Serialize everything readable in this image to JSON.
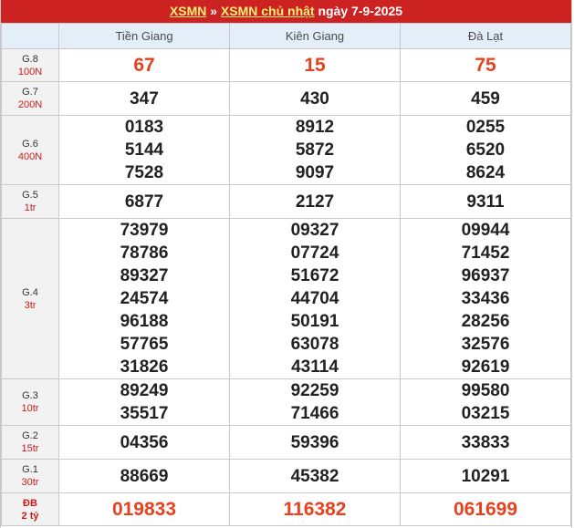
{
  "header": {
    "link1": "XSMN",
    "separator": "»",
    "link2": "XSMN chủ nhật",
    "date_text": "ngày 7-9-2025"
  },
  "provinces": [
    "Tiền Giang",
    "Kiên Giang",
    "Đà Lạt"
  ],
  "prizes": [
    {
      "name": "G.8",
      "value": "100N",
      "results": [
        [
          "67"
        ],
        [
          "15"
        ],
        [
          "75"
        ]
      ]
    },
    {
      "name": "G.7",
      "value": "200N",
      "results": [
        [
          "347"
        ],
        [
          "430"
        ],
        [
          "459"
        ]
      ]
    },
    {
      "name": "G.6",
      "value": "400N",
      "results": [
        [
          "0183",
          "5144",
          "7528"
        ],
        [
          "8912",
          "5872",
          "9097"
        ],
        [
          "0255",
          "6520",
          "8624"
        ]
      ]
    },
    {
      "name": "G.5",
      "value": "1tr",
      "results": [
        [
          "6877"
        ],
        [
          "2127"
        ],
        [
          "9311"
        ]
      ]
    },
    {
      "name": "G.4",
      "value": "3tr",
      "results": [
        [
          "73979",
          "78786",
          "89327",
          "24574",
          "96188",
          "57765",
          "31826"
        ],
        [
          "09327",
          "07724",
          "51672",
          "44704",
          "50191",
          "63078",
          "43114"
        ],
        [
          "09944",
          "71452",
          "96937",
          "33436",
          "28256",
          "32576",
          "92619"
        ]
      ]
    },
    {
      "name": "G.3",
      "value": "10tr",
      "results": [
        [
          "89249",
          "35517"
        ],
        [
          "92259",
          "71466"
        ],
        [
          "99580",
          "03215"
        ]
      ]
    },
    {
      "name": "G.2",
      "value": "15tr",
      "results": [
        [
          "04356"
        ],
        [
          "59396"
        ],
        [
          "33833"
        ]
      ]
    },
    {
      "name": "G.1",
      "value": "30tr",
      "results": [
        [
          "88669"
        ],
        [
          "45382"
        ],
        [
          "10291"
        ]
      ]
    },
    {
      "name": "ĐB",
      "value": "2 tỷ",
      "results": [
        [
          "019833"
        ],
        [
          "116382"
        ],
        [
          "061699"
        ]
      ]
    }
  ],
  "colors": {
    "header_bg": "#cc2222",
    "link": "#fff176",
    "highlight": "#e8411e",
    "prize_label": "#cc1a1a"
  }
}
